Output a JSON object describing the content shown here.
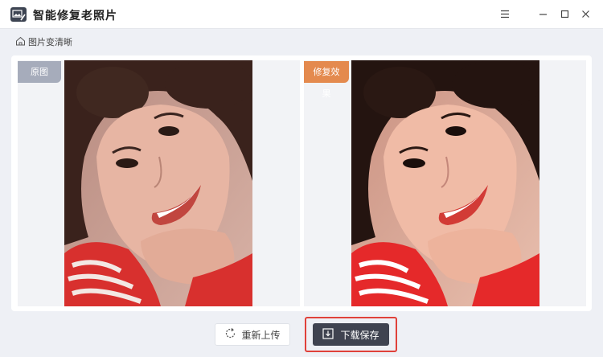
{
  "app": {
    "title": "智能修复老照片",
    "logo_icon": "photo-repair-app-icon"
  },
  "window_controls": {
    "menu_icon": "hamburger-menu-icon",
    "minimize_icon": "minimize-icon",
    "maximize_icon": "maximize-icon",
    "close_icon": "close-icon"
  },
  "breadcrumb": {
    "icon": "home-icon",
    "label": "图片变清晰"
  },
  "panels": {
    "original_label": "原图",
    "result_label": "修复效果"
  },
  "actions": {
    "reupload_label": "重新上传",
    "reupload_icon": "refresh-icon",
    "download_label": "下载保存",
    "download_icon": "download-icon"
  },
  "colors": {
    "original_tag": "#a6acbb",
    "result_tag": "#e48a4e",
    "download_button": "#3f4350",
    "highlight": "#e0413a"
  }
}
